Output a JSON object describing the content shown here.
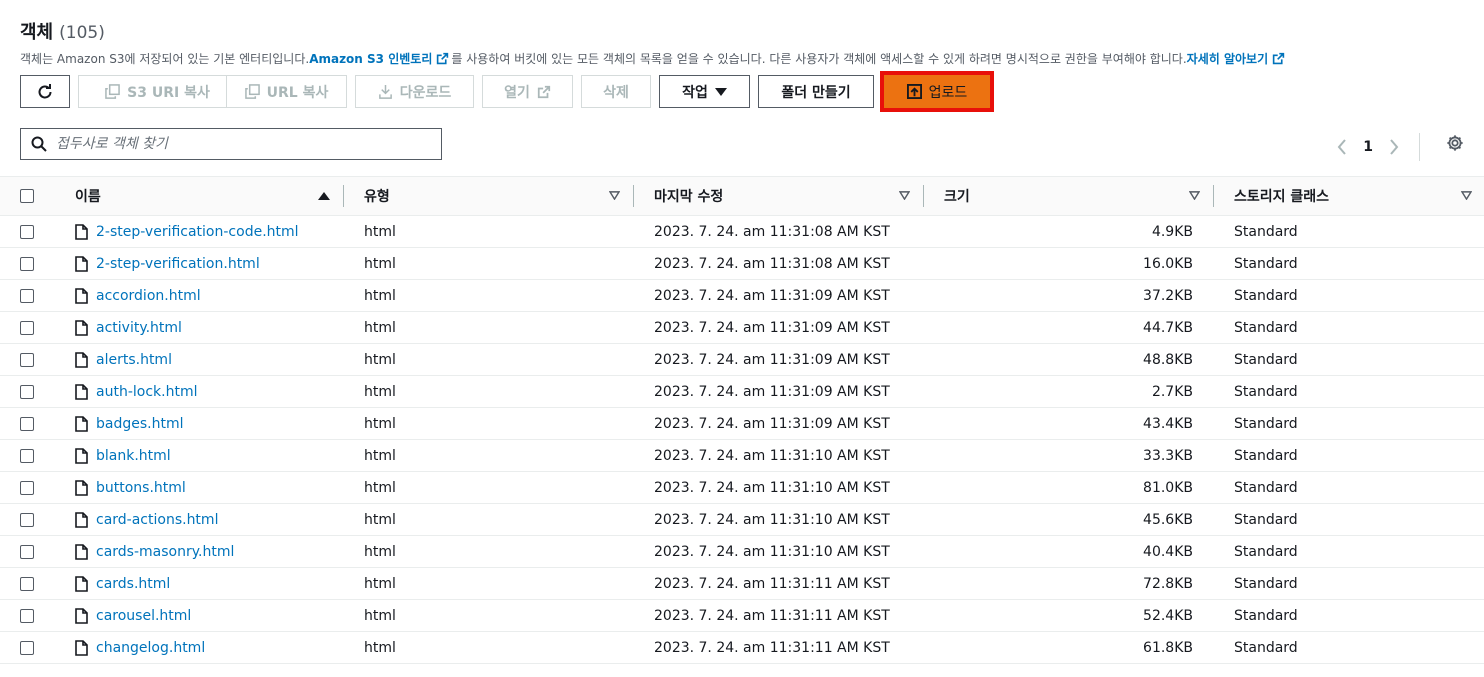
{
  "header": {
    "title": "객체",
    "count": "(105)",
    "desc_part1": "객체는 Amazon S3에 저장되어 있는 기본 엔터티입니다. ",
    "desc_link1": "Amazon S3 인벤토리",
    "desc_part2": "를 사용하여 버킷에 있는 모든 객체의 목록을 얻을 수 있습니다. 다른 사용자가 객체에 액세스할 수 있게 하려면 명시적으로 권한을 부여해야 합니다. ",
    "desc_link2": "자세히 알아보기"
  },
  "toolbar": {
    "copy_s3_uri": "S3 URI 복사",
    "copy_url": "URL 복사",
    "download": "다운로드",
    "open": "열기",
    "delete": "삭제",
    "actions": "작업",
    "create_folder": "폴더 만들기",
    "upload": "업로드"
  },
  "search": {
    "placeholder": "접두사로 객체 찾기"
  },
  "pagination": {
    "current_page": "1"
  },
  "table": {
    "columns": {
      "name": "이름",
      "type": "유형",
      "last_modified": "마지막 수정",
      "size": "크기",
      "storage_class": "스토리지 클래스"
    },
    "rows": [
      {
        "name": "2-step-verification-code.html",
        "type": "html",
        "modified": "2023. 7. 24. am 11:31:08 AM KST",
        "size": "4.9KB",
        "class": "Standard"
      },
      {
        "name": "2-step-verification.html",
        "type": "html",
        "modified": "2023. 7. 24. am 11:31:08 AM KST",
        "size": "16.0KB",
        "class": "Standard"
      },
      {
        "name": "accordion.html",
        "type": "html",
        "modified": "2023. 7. 24. am 11:31:09 AM KST",
        "size": "37.2KB",
        "class": "Standard"
      },
      {
        "name": "activity.html",
        "type": "html",
        "modified": "2023. 7. 24. am 11:31:09 AM KST",
        "size": "44.7KB",
        "class": "Standard"
      },
      {
        "name": "alerts.html",
        "type": "html",
        "modified": "2023. 7. 24. am 11:31:09 AM KST",
        "size": "48.8KB",
        "class": "Standard"
      },
      {
        "name": "auth-lock.html",
        "type": "html",
        "modified": "2023. 7. 24. am 11:31:09 AM KST",
        "size": "2.7KB",
        "class": "Standard"
      },
      {
        "name": "badges.html",
        "type": "html",
        "modified": "2023. 7. 24. am 11:31:09 AM KST",
        "size": "43.4KB",
        "class": "Standard"
      },
      {
        "name": "blank.html",
        "type": "html",
        "modified": "2023. 7. 24. am 11:31:10 AM KST",
        "size": "33.3KB",
        "class": "Standard"
      },
      {
        "name": "buttons.html",
        "type": "html",
        "modified": "2023. 7. 24. am 11:31:10 AM KST",
        "size": "81.0KB",
        "class": "Standard"
      },
      {
        "name": "card-actions.html",
        "type": "html",
        "modified": "2023. 7. 24. am 11:31:10 AM KST",
        "size": "45.6KB",
        "class": "Standard"
      },
      {
        "name": "cards-masonry.html",
        "type": "html",
        "modified": "2023. 7. 24. am 11:31:10 AM KST",
        "size": "40.4KB",
        "class": "Standard"
      },
      {
        "name": "cards.html",
        "type": "html",
        "modified": "2023. 7. 24. am 11:31:11 AM KST",
        "size": "72.8KB",
        "class": "Standard"
      },
      {
        "name": "carousel.html",
        "type": "html",
        "modified": "2023. 7. 24. am 11:31:11 AM KST",
        "size": "52.4KB",
        "class": "Standard"
      },
      {
        "name": "changelog.html",
        "type": "html",
        "modified": "2023. 7. 24. am 11:31:11 AM KST",
        "size": "61.8KB",
        "class": "Standard"
      }
    ]
  },
  "colors": {
    "link": "#0073bb",
    "primary_button": "#ec7211",
    "highlight_outline": "#e8100a"
  },
  "icons": [
    "refresh-icon",
    "copy-icon",
    "download-icon",
    "external-link-icon",
    "caret-down-icon",
    "upload-icon",
    "search-icon",
    "chevron-left-icon",
    "chevron-right-icon",
    "gear-icon",
    "sort-ascending-icon",
    "file-icon"
  ]
}
